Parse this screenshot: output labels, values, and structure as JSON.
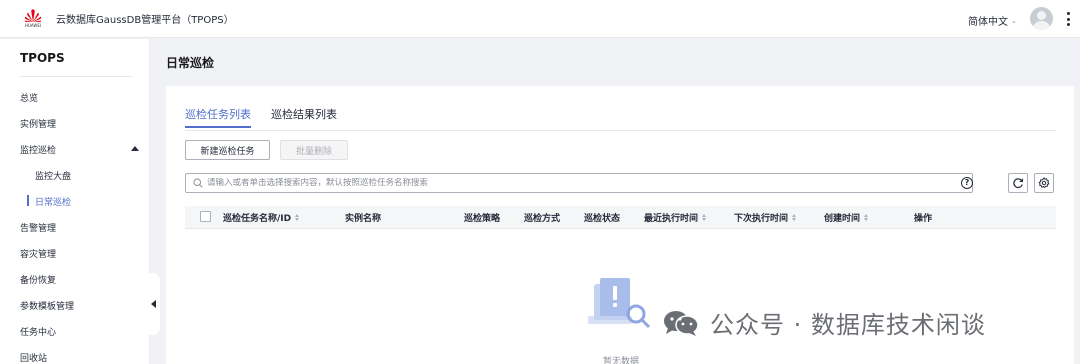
{
  "header": {
    "logo_text": "HUAWEI",
    "app_title": "云数据库GaussDB管理平台（TPOPS）",
    "language": "简体中文"
  },
  "sidebar": {
    "title": "TPOPS",
    "items": [
      {
        "label": "总览"
      },
      {
        "label": "实例管理"
      },
      {
        "label": "监控巡检"
      },
      {
        "label": "监控大盘"
      },
      {
        "label": "日常巡检"
      },
      {
        "label": "告警管理"
      },
      {
        "label": "容灾管理"
      },
      {
        "label": "备份恢复"
      },
      {
        "label": "参数模板管理"
      },
      {
        "label": "任务中心"
      },
      {
        "label": "回收站"
      }
    ]
  },
  "main": {
    "page_title": "日常巡检",
    "tabs": [
      {
        "label": "巡检任务列表",
        "active": true
      },
      {
        "label": "巡检结果列表",
        "active": false
      }
    ],
    "buttons": {
      "new_task": "新建巡检任务",
      "batch_delete": "批量删除"
    },
    "search": {
      "placeholder": "请输入或者单击选择搜索内容，默认按照巡检任务名称搜索"
    },
    "table": {
      "columns": [
        {
          "label": "巡检任务名称/ID",
          "sortable": true
        },
        {
          "label": "实例名称",
          "sortable": false
        },
        {
          "label": "巡检策略",
          "sortable": false
        },
        {
          "label": "巡检方式",
          "sortable": false
        },
        {
          "label": "巡检状态",
          "sortable": false
        },
        {
          "label": "最近执行时间",
          "sortable": true
        },
        {
          "label": "下次执行时间",
          "sortable": true
        },
        {
          "label": "创建时间",
          "sortable": true
        },
        {
          "label": "操作",
          "sortable": false
        }
      ],
      "empty_text": "暂无数据"
    }
  },
  "watermark": {
    "text": "公众号 · 数据库技术闲谈"
  },
  "colors": {
    "accent": "#526ecc",
    "brand_red": "#e60012",
    "text": "#252b3a",
    "muted": "#8a8e99"
  }
}
